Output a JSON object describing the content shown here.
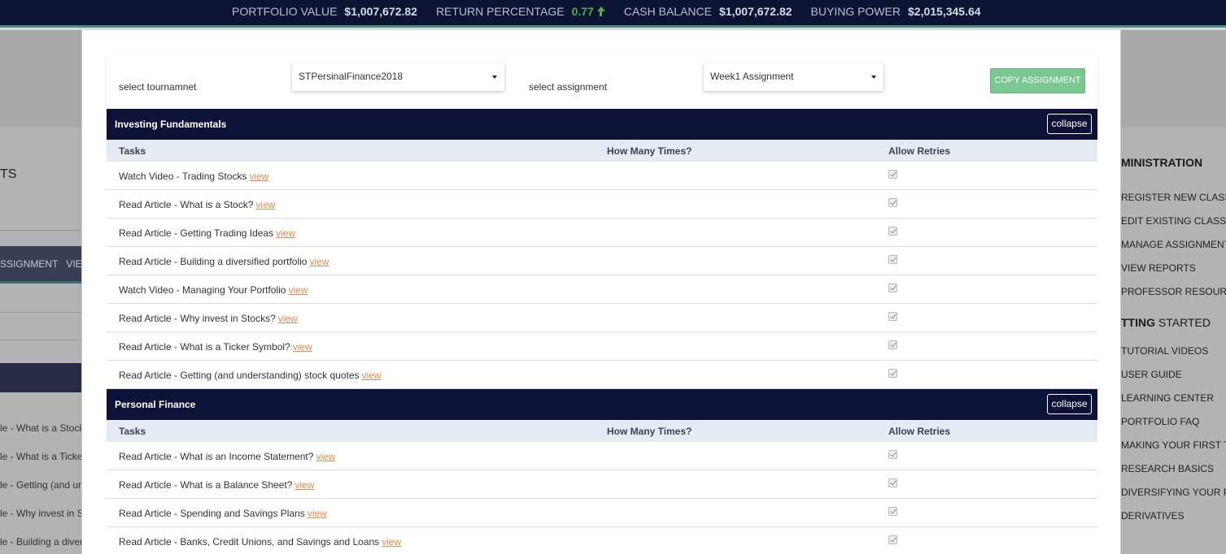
{
  "topbar": {
    "stats": [
      {
        "label": "PORTFOLIO VALUE",
        "value": "$1,007,672.82"
      },
      {
        "label": "RETURN PERCENTAGE",
        "value": "0.77",
        "trend_icon": "arrow-up-icon",
        "color": "#4caf50"
      },
      {
        "label": "CASH BALANCE",
        "value": "$1,007,672.82"
      },
      {
        "label": "BUYING POWER",
        "value": "$2,015,345.64"
      }
    ]
  },
  "background": {
    "left_heading": "TS",
    "nav": [
      "SSIGNMENT",
      "VIE"
    ],
    "list": [
      "le - What is a Stock",
      "le - What is a Ticke",
      "le - Getting (and un",
      "le - Why invest in S",
      "le - Building a diver"
    ],
    "right_panel": {
      "admin_heading": "MINISTRATION",
      "admin_items": [
        "REGISTER NEW CLASS",
        "EDIT EXISTING CLASS",
        "MANAGE ASSIGNMENTS",
        "VIEW REPORTS",
        "PROFESSOR RESOURCES"
      ],
      "getting_started_bold": "TTING",
      "getting_started_rest": " STARTED",
      "getting_started_items": [
        "TUTORIAL VIDEOS",
        "USER GUIDE",
        "LEARNING CENTER",
        "PORTFOLIO FAQ",
        "MAKING YOUR FIRST TR",
        "RESEARCH BASICS",
        "DIVERSIFYING YOUR PO",
        "DERIVATIVES"
      ]
    }
  },
  "modal": {
    "tournament_label": "select tournamnet",
    "tournament_value": "STPersinalFinance2018",
    "assignment_label": "select assignment",
    "assignment_value": "Week1 Assignment",
    "copy_button": "COPY ASSIGNMENT",
    "columns": {
      "tasks": "Tasks",
      "times": "How Many Times?",
      "retries": "Allow Retries"
    },
    "view_link": "view",
    "collapse_label": "collapse",
    "sections": [
      {
        "title": "Investing Fundamentals",
        "tasks": [
          {
            "name": "Watch Video - Trading Stocks",
            "allow_retries": true
          },
          {
            "name": "Read Article - What is a Stock?",
            "allow_retries": true
          },
          {
            "name": "Read Article - Getting Trading Ideas",
            "allow_retries": true
          },
          {
            "name": "Read Article - Building a diversified portfolio",
            "allow_retries": true
          },
          {
            "name": "Watch Video - Managing Your Portfolio",
            "allow_retries": true
          },
          {
            "name": "Read Article - Why invest in Stocks?",
            "allow_retries": true
          },
          {
            "name": "Read Article - What is a Ticker Symbol?",
            "allow_retries": true
          },
          {
            "name": "Read Article - Getting (and understanding) stock quotes",
            "allow_retries": true
          }
        ]
      },
      {
        "title": "Personal Finance",
        "tasks": [
          {
            "name": "Read Article - What is an Income Statement?",
            "allow_retries": true
          },
          {
            "name": "Read Article - What is a Balance Sheet?",
            "allow_retries": true
          },
          {
            "name": "Read Article - Spending and Savings Plans",
            "allow_retries": true
          },
          {
            "name": "Read Article - Banks, Credit Unions, and Savings and Loans",
            "allow_retries": true
          }
        ]
      }
    ]
  }
}
